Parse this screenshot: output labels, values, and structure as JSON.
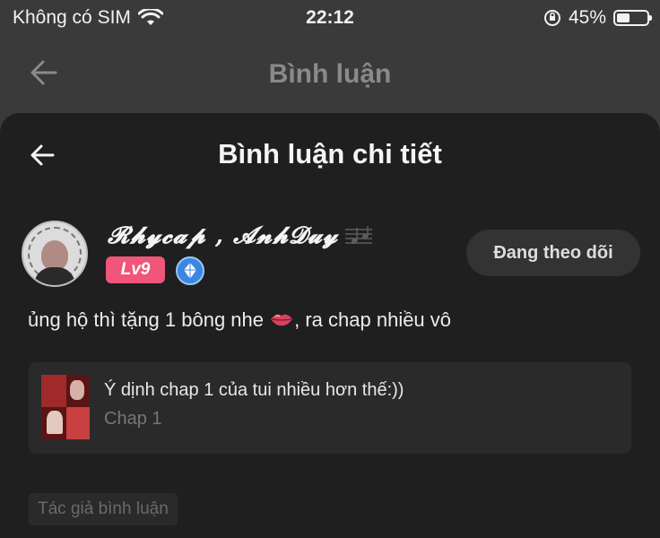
{
  "status_bar": {
    "carrier": "Không có SIM",
    "time": "22:12",
    "battery_percent": "45%",
    "battery_level": 0.45,
    "icons": [
      "wifi-icon",
      "rotation-lock-icon",
      "battery-icon"
    ]
  },
  "background_header": {
    "title": "Bình luận"
  },
  "sheet": {
    "title": "Bình luận chi tiết",
    "user": {
      "name": "𝓡𝓱𝔂𝓬𝓪𝓹 , 𝓐𝓷𝓱𝓓𝓾𝔂",
      "level": "Lv9",
      "follow_label": "Đang theo dõi"
    },
    "comment": {
      "text_before": "ủng hộ thì tặng 1 bông nhe ",
      "text_after": ", ra chap nhiều vô"
    },
    "chapter": {
      "title": "Ý dịnh chap 1 của tui nhiều hơn thế:))",
      "subtitle": "Chap 1"
    },
    "author_tag": "Tác giả bình luận"
  },
  "colors": {
    "level_badge": "#f0557a",
    "gem_badge": "#3a86e0",
    "sheet_bg": "#1f1f1f",
    "backdrop": "#3a3a3a"
  }
}
